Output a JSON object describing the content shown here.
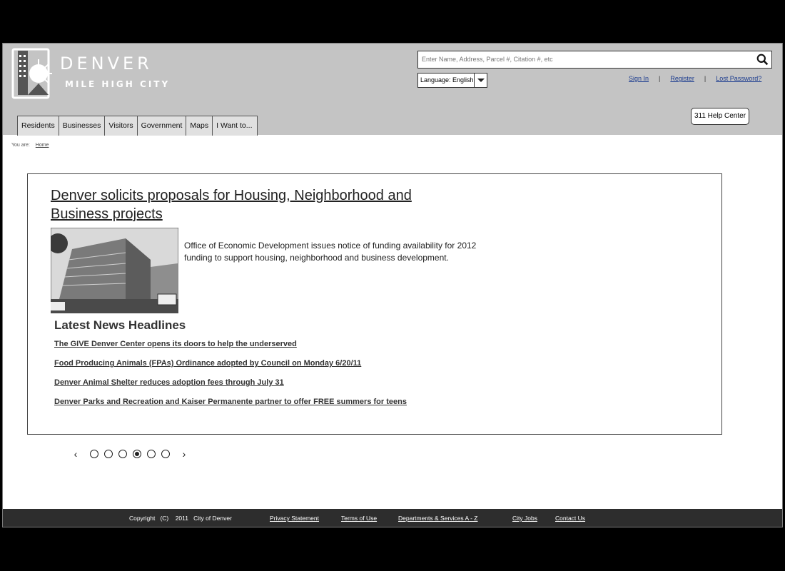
{
  "brand": {
    "name": "DENVER",
    "tagline": "MILE HIGH CITY"
  },
  "search": {
    "placeholder": "Enter Name, Address, Parcel #, Citation #, etc"
  },
  "language": {
    "label": "Language: English"
  },
  "account": {
    "sign_in": "Sign In",
    "register": "Register",
    "lost_password": "Lost Password?",
    "separator": "|"
  },
  "help_center": "311 Help Center",
  "nav": [
    "Residents",
    "Businesses",
    "Visitors",
    "Government",
    "Maps",
    "I Want to..."
  ],
  "breadcrumb": {
    "label": "You are:",
    "home": "Home"
  },
  "feature": {
    "title": "Denver solicits proposals for Housing, Neighborhood and Business projects",
    "description": "Office of Economic Development issues notice of funding availability for 2012 funding to support housing, neighborhood and business development."
  },
  "news": {
    "heading": "Latest News Headlines",
    "items": [
      "The GIVE Denver Center opens its doors to help the underserved",
      "Food Producing Animals (FPAs) Ordinance adopted by Council on Monday 6/20/11",
      "Denver Animal Shelter reduces adoption fees through July 31",
      "Denver Parks and Recreation and Kaiser Permanente partner to offer FREE summers for teens"
    ]
  },
  "pager": {
    "prev": "‹",
    "next": "›",
    "total": 6,
    "active": 4
  },
  "footer": {
    "copyright": "Copyright   (C)    2011   City of Denver",
    "links": [
      "Privacy Statement",
      "Terms of Use",
      "Departments & Services A - Z",
      "City Jobs",
      "Contact Us"
    ]
  }
}
